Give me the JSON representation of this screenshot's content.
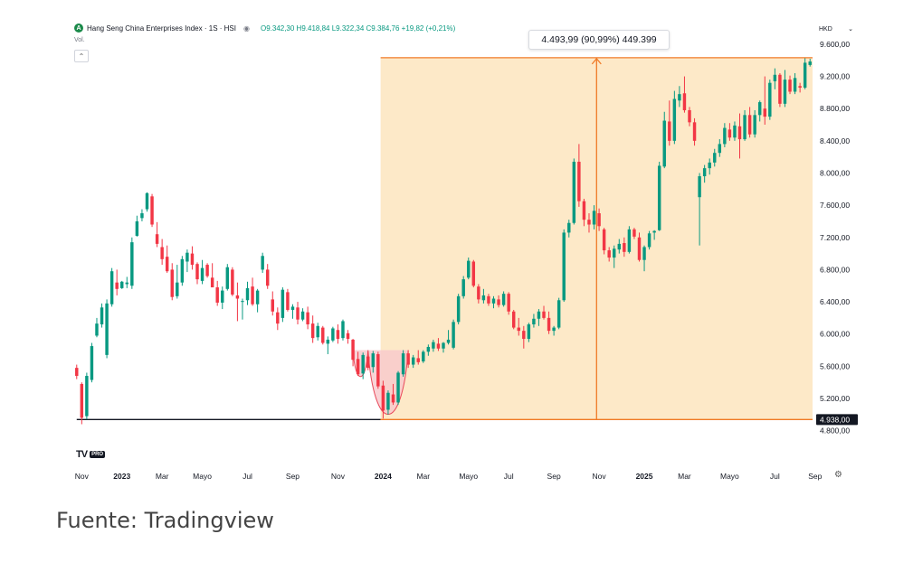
{
  "header": {
    "logo_letter": "A",
    "symbol": "Hang Seng China Enterprises Index · 1S · HSI",
    "ohlc": "O9.342,30 H9.418,84 L9.322,34 C9.384,76 +19,82 (+0,21%)",
    "eye_icon": "eye-icon",
    "volume_label": "Vol.",
    "collapse_icon": "chevron-up-icon"
  },
  "currency": {
    "label": "HKD",
    "dropdown_icon": "chevron-down-icon"
  },
  "measure_tooltip": "4.493,99 (90,99%) 449.399",
  "branding": {
    "mark": "TV",
    "badge": "PRO"
  },
  "settings_icon": "gear-icon",
  "source": "Fuente: Tradingview",
  "colors": {
    "up": "#089981",
    "down": "#f23645",
    "measure_fill": "#fde9c8",
    "measure_line": "#f07a27",
    "pattern_fill": "#f8c8cc",
    "baseline": "#131722"
  },
  "chart_data": {
    "type": "candlestick",
    "title": "Hang Seng China Enterprises Index · 1S · HSI",
    "interval": "1S",
    "currency": "HKD",
    "ylim": [
      4650,
      9700
    ],
    "y_ticks": [
      {
        "value": 9600,
        "label": "9.600,00"
      },
      {
        "value": 9200,
        "label": "9.200,00"
      },
      {
        "value": 8800,
        "label": "8.800,00"
      },
      {
        "value": 8400,
        "label": "8.400,00"
      },
      {
        "value": 8000,
        "label": "8.000,00"
      },
      {
        "value": 7600,
        "label": "7.600,00"
      },
      {
        "value": 7200,
        "label": "7.200,00"
      },
      {
        "value": 6800,
        "label": "6.800,00"
      },
      {
        "value": 6400,
        "label": "6.400,00"
      },
      {
        "value": 6000,
        "label": "6.000,00"
      },
      {
        "value": 5600,
        "label": "5.600,00"
      },
      {
        "value": 5200,
        "label": "5.200,00"
      },
      {
        "value": 4800,
        "label": "4.800,00"
      }
    ],
    "x_ticks": [
      {
        "index": 1,
        "label": "Nov",
        "bold": false
      },
      {
        "index": 9,
        "label": "2023",
        "bold": true
      },
      {
        "index": 17,
        "label": "Mar",
        "bold": false
      },
      {
        "index": 25,
        "label": "Mayo",
        "bold": false
      },
      {
        "index": 34,
        "label": "Jul",
        "bold": false
      },
      {
        "index": 43,
        "label": "Sep",
        "bold": false
      },
      {
        "index": 52,
        "label": "Nov",
        "bold": false
      },
      {
        "index": 61,
        "label": "2024",
        "bold": true
      },
      {
        "index": 69,
        "label": "Mar",
        "bold": false
      },
      {
        "index": 78,
        "label": "Mayo",
        "bold": false
      },
      {
        "index": 86,
        "label": "Jul",
        "bold": false
      },
      {
        "index": 95,
        "label": "Sep",
        "bold": false
      },
      {
        "index": 104,
        "label": "Nov",
        "bold": false
      },
      {
        "index": 113,
        "label": "2025",
        "bold": true
      },
      {
        "index": 121,
        "label": "Mar",
        "bold": false
      },
      {
        "index": 130,
        "label": "Mayo",
        "bold": false
      },
      {
        "index": 139,
        "label": "Jul",
        "bold": false
      },
      {
        "index": 147,
        "label": "Sep",
        "bold": false
      }
    ],
    "price_label": {
      "value": 4938,
      "label": "4.938,00"
    },
    "baseline_start_index": 1,
    "measure": {
      "from_index": 61,
      "low": 4938,
      "high": 9432
    },
    "rounding_bottoms": [
      {
        "from_index": 55,
        "to_index": 58,
        "level": 5800,
        "bottom": 5450
      },
      {
        "from_index": 58,
        "to_index": 66,
        "level": 5800,
        "bottom": 4950
      }
    ],
    "candles": [
      {
        "o": 5580,
        "h": 5620,
        "l": 5440,
        "c": 5480
      },
      {
        "o": 5380,
        "h": 5400,
        "l": 4880,
        "c": 4960
      },
      {
        "o": 4980,
        "h": 5520,
        "l": 4940,
        "c": 5480
      },
      {
        "o": 5430,
        "h": 5890,
        "l": 5400,
        "c": 5850
      },
      {
        "o": 5980,
        "h": 6200,
        "l": 5960,
        "c": 6130
      },
      {
        "o": 6120,
        "h": 6380,
        "l": 6080,
        "c": 6330
      },
      {
        "o": 5740,
        "h": 6430,
        "l": 5700,
        "c": 6380
      },
      {
        "o": 6370,
        "h": 6820,
        "l": 6340,
        "c": 6780
      },
      {
        "o": 6640,
        "h": 6800,
        "l": 6480,
        "c": 6560
      },
      {
        "o": 6570,
        "h": 6660,
        "l": 6560,
        "c": 6650
      },
      {
        "o": 6620,
        "h": 6710,
        "l": 6570,
        "c": 6640
      },
      {
        "o": 6600,
        "h": 7200,
        "l": 6560,
        "c": 7140
      },
      {
        "o": 7220,
        "h": 7470,
        "l": 7210,
        "c": 7400
      },
      {
        "o": 7440,
        "h": 7550,
        "l": 7400,
        "c": 7500
      },
      {
        "o": 7550,
        "h": 7760,
        "l": 7520,
        "c": 7750
      },
      {
        "o": 7710,
        "h": 7740,
        "l": 7330,
        "c": 7360
      },
      {
        "o": 7240,
        "h": 7390,
        "l": 7080,
        "c": 7120
      },
      {
        "o": 7080,
        "h": 7180,
        "l": 6860,
        "c": 6930
      },
      {
        "o": 6960,
        "h": 7100,
        "l": 6760,
        "c": 6780
      },
      {
        "o": 6800,
        "h": 6880,
        "l": 6420,
        "c": 6460
      },
      {
        "o": 6470,
        "h": 6860,
        "l": 6440,
        "c": 6640
      },
      {
        "o": 6640,
        "h": 6970,
        "l": 6600,
        "c": 6930
      },
      {
        "o": 6900,
        "h": 7050,
        "l": 6770,
        "c": 7010
      },
      {
        "o": 7000,
        "h": 7090,
        "l": 6800,
        "c": 6860
      },
      {
        "o": 6870,
        "h": 6890,
        "l": 6620,
        "c": 6680
      },
      {
        "o": 6660,
        "h": 6920,
        "l": 6620,
        "c": 6820
      },
      {
        "o": 6860,
        "h": 6880,
        "l": 6700,
        "c": 6720
      },
      {
        "o": 6700,
        "h": 6880,
        "l": 6580,
        "c": 6580
      },
      {
        "o": 6580,
        "h": 6660,
        "l": 6350,
        "c": 6390
      },
      {
        "o": 6390,
        "h": 6590,
        "l": 6310,
        "c": 6540
      },
      {
        "o": 6560,
        "h": 6870,
        "l": 6540,
        "c": 6830
      },
      {
        "o": 6800,
        "h": 6830,
        "l": 6470,
        "c": 6490
      },
      {
        "o": 6480,
        "h": 6640,
        "l": 6160,
        "c": 6440
      },
      {
        "o": 6400,
        "h": 6440,
        "l": 6180,
        "c": 6410
      },
      {
        "o": 6420,
        "h": 6650,
        "l": 6360,
        "c": 6570
      },
      {
        "o": 6590,
        "h": 6700,
        "l": 6350,
        "c": 6370
      },
      {
        "o": 6370,
        "h": 6560,
        "l": 6270,
        "c": 6540
      },
      {
        "o": 6800,
        "h": 7010,
        "l": 6760,
        "c": 6970
      },
      {
        "o": 6800,
        "h": 6870,
        "l": 6560,
        "c": 6600
      },
      {
        "o": 6430,
        "h": 6530,
        "l": 6230,
        "c": 6280
      },
      {
        "o": 6270,
        "h": 6330,
        "l": 6050,
        "c": 6130
      },
      {
        "o": 6200,
        "h": 6580,
        "l": 6150,
        "c": 6550
      },
      {
        "o": 6520,
        "h": 6560,
        "l": 6280,
        "c": 6300
      },
      {
        "o": 6300,
        "h": 6370,
        "l": 6190,
        "c": 6340
      },
      {
        "o": 6330,
        "h": 6400,
        "l": 6120,
        "c": 6180
      },
      {
        "o": 6180,
        "h": 6320,
        "l": 6160,
        "c": 6280
      },
      {
        "o": 6270,
        "h": 6340,
        "l": 6060,
        "c": 6120
      },
      {
        "o": 6130,
        "h": 6230,
        "l": 5890,
        "c": 5950
      },
      {
        "o": 5960,
        "h": 6140,
        "l": 5920,
        "c": 6100
      },
      {
        "o": 6080,
        "h": 6100,
        "l": 5870,
        "c": 5890
      },
      {
        "o": 5880,
        "h": 5970,
        "l": 5750,
        "c": 5930
      },
      {
        "o": 5920,
        "h": 6090,
        "l": 5900,
        "c": 6070
      },
      {
        "o": 6050,
        "h": 6120,
        "l": 5880,
        "c": 5940
      },
      {
        "o": 5950,
        "h": 6180,
        "l": 5920,
        "c": 6160
      },
      {
        "o": 6010,
        "h": 6050,
        "l": 5880,
        "c": 5940
      },
      {
        "o": 5930,
        "h": 5940,
        "l": 5600,
        "c": 5680
      },
      {
        "o": 5690,
        "h": 5780,
        "l": 5480,
        "c": 5500
      },
      {
        "o": 5510,
        "h": 5770,
        "l": 5440,
        "c": 5740
      },
      {
        "o": 5720,
        "h": 5780,
        "l": 5550,
        "c": 5580
      },
      {
        "o": 5590,
        "h": 5790,
        "l": 5520,
        "c": 5760
      },
      {
        "o": 5750,
        "h": 5780,
        "l": 5320,
        "c": 5350
      },
      {
        "o": 5360,
        "h": 5420,
        "l": 4950,
        "c": 5050
      },
      {
        "o": 5060,
        "h": 5300,
        "l": 5000,
        "c": 5270
      },
      {
        "o": 5250,
        "h": 5380,
        "l": 5120,
        "c": 5150
      },
      {
        "o": 5150,
        "h": 5540,
        "l": 5120,
        "c": 5520
      },
      {
        "o": 5500,
        "h": 5800,
        "l": 5470,
        "c": 5760
      },
      {
        "o": 5760,
        "h": 5800,
        "l": 5580,
        "c": 5620
      },
      {
        "o": 5620,
        "h": 5740,
        "l": 5580,
        "c": 5710
      },
      {
        "o": 5700,
        "h": 5800,
        "l": 5620,
        "c": 5650
      },
      {
        "o": 5660,
        "h": 5800,
        "l": 5640,
        "c": 5780
      },
      {
        "o": 5780,
        "h": 5870,
        "l": 5730,
        "c": 5840
      },
      {
        "o": 5820,
        "h": 5930,
        "l": 5780,
        "c": 5900
      },
      {
        "o": 5880,
        "h": 5950,
        "l": 5790,
        "c": 5820
      },
      {
        "o": 5820,
        "h": 5900,
        "l": 5770,
        "c": 5890
      },
      {
        "o": 5890,
        "h": 6050,
        "l": 5870,
        "c": 5930
      },
      {
        "o": 5830,
        "h": 6180,
        "l": 5810,
        "c": 6150
      },
      {
        "o": 6150,
        "h": 6500,
        "l": 6120,
        "c": 6470
      },
      {
        "o": 6470,
        "h": 6720,
        "l": 6440,
        "c": 6680
      },
      {
        "o": 6700,
        "h": 6950,
        "l": 6680,
        "c": 6910
      },
      {
        "o": 6900,
        "h": 6920,
        "l": 6580,
        "c": 6600
      },
      {
        "o": 6590,
        "h": 6620,
        "l": 6380,
        "c": 6430
      },
      {
        "o": 6420,
        "h": 6560,
        "l": 6380,
        "c": 6480
      },
      {
        "o": 6470,
        "h": 6500,
        "l": 6350,
        "c": 6380
      },
      {
        "o": 6380,
        "h": 6470,
        "l": 6320,
        "c": 6440
      },
      {
        "o": 6430,
        "h": 6480,
        "l": 6330,
        "c": 6360
      },
      {
        "o": 6360,
        "h": 6530,
        "l": 6340,
        "c": 6500
      },
      {
        "o": 6500,
        "h": 6520,
        "l": 6240,
        "c": 6280
      },
      {
        "o": 6280,
        "h": 6300,
        "l": 6060,
        "c": 6080
      },
      {
        "o": 6080,
        "h": 6200,
        "l": 5980,
        "c": 6040
      },
      {
        "o": 6040,
        "h": 6100,
        "l": 5820,
        "c": 5940
      },
      {
        "o": 5940,
        "h": 6140,
        "l": 5900,
        "c": 6120
      },
      {
        "o": 6120,
        "h": 6250,
        "l": 6080,
        "c": 6190
      },
      {
        "o": 6190,
        "h": 6310,
        "l": 6100,
        "c": 6280
      },
      {
        "o": 6280,
        "h": 6350,
        "l": 6180,
        "c": 6200
      },
      {
        "o": 6200,
        "h": 6280,
        "l": 6000,
        "c": 6040
      },
      {
        "o": 6040,
        "h": 6100,
        "l": 5980,
        "c": 6080
      },
      {
        "o": 6080,
        "h": 6450,
        "l": 6060,
        "c": 6420
      },
      {
        "o": 6420,
        "h": 7300,
        "l": 6400,
        "c": 7260
      },
      {
        "o": 7260,
        "h": 7420,
        "l": 7200,
        "c": 7380
      },
      {
        "o": 7380,
        "h": 8180,
        "l": 7360,
        "c": 8140
      },
      {
        "o": 8140,
        "h": 8360,
        "l": 7580,
        "c": 7650
      },
      {
        "o": 7650,
        "h": 7680,
        "l": 7340,
        "c": 7420
      },
      {
        "o": 7420,
        "h": 7500,
        "l": 7260,
        "c": 7360
      },
      {
        "o": 7360,
        "h": 7600,
        "l": 7300,
        "c": 7530
      },
      {
        "o": 7500,
        "h": 7560,
        "l": 7280,
        "c": 7340
      },
      {
        "o": 7300,
        "h": 7320,
        "l": 6990,
        "c": 7040
      },
      {
        "o": 7040,
        "h": 7080,
        "l": 6900,
        "c": 6950
      },
      {
        "o": 6950,
        "h": 7100,
        "l": 6820,
        "c": 7060
      },
      {
        "o": 7050,
        "h": 7180,
        "l": 7000,
        "c": 7120
      },
      {
        "o": 7130,
        "h": 7200,
        "l": 6960,
        "c": 7020
      },
      {
        "o": 7020,
        "h": 7340,
        "l": 7000,
        "c": 7300
      },
      {
        "o": 7300,
        "h": 7320,
        "l": 7180,
        "c": 7210
      },
      {
        "o": 7200,
        "h": 7260,
        "l": 6900,
        "c": 6920
      },
      {
        "o": 6920,
        "h": 7100,
        "l": 6780,
        "c": 7080
      },
      {
        "o": 7080,
        "h": 7280,
        "l": 7050,
        "c": 7250
      },
      {
        "o": 7260,
        "h": 7290,
        "l": 7170,
        "c": 7280
      },
      {
        "o": 7290,
        "h": 8140,
        "l": 7280,
        "c": 8090
      },
      {
        "o": 8080,
        "h": 8760,
        "l": 8060,
        "c": 8650
      },
      {
        "o": 8640,
        "h": 8900,
        "l": 8340,
        "c": 8400
      },
      {
        "o": 8400,
        "h": 9020,
        "l": 8360,
        "c": 8920
      },
      {
        "o": 8900,
        "h": 9080,
        "l": 8820,
        "c": 8980
      },
      {
        "o": 8990,
        "h": 9200,
        "l": 8750,
        "c": 8780
      },
      {
        "o": 8780,
        "h": 8820,
        "l": 8580,
        "c": 8630
      },
      {
        "o": 8630,
        "h": 8680,
        "l": 8340,
        "c": 8400
      },
      {
        "o": 7700,
        "h": 8000,
        "l": 7100,
        "c": 7960
      },
      {
        "o": 7960,
        "h": 8100,
        "l": 7880,
        "c": 8060
      },
      {
        "o": 8060,
        "h": 8180,
        "l": 7980,
        "c": 8130
      },
      {
        "o": 8130,
        "h": 8300,
        "l": 8080,
        "c": 8250
      },
      {
        "o": 8250,
        "h": 8420,
        "l": 8200,
        "c": 8360
      },
      {
        "o": 8360,
        "h": 8620,
        "l": 8320,
        "c": 8560
      },
      {
        "o": 8540,
        "h": 8620,
        "l": 8400,
        "c": 8440
      },
      {
        "o": 8440,
        "h": 8640,
        "l": 8400,
        "c": 8590
      },
      {
        "o": 8580,
        "h": 8740,
        "l": 8180,
        "c": 8420
      },
      {
        "o": 8420,
        "h": 8780,
        "l": 8400,
        "c": 8720
      },
      {
        "o": 8720,
        "h": 8820,
        "l": 8440,
        "c": 8480
      },
      {
        "o": 8480,
        "h": 8780,
        "l": 8440,
        "c": 8720
      },
      {
        "o": 8720,
        "h": 8900,
        "l": 8640,
        "c": 8880
      },
      {
        "o": 8800,
        "h": 9200,
        "l": 8600,
        "c": 8700
      },
      {
        "o": 8700,
        "h": 9160,
        "l": 8660,
        "c": 9120
      },
      {
        "o": 9140,
        "h": 9300,
        "l": 9040,
        "c": 9220
      },
      {
        "o": 9220,
        "h": 9240,
        "l": 8820,
        "c": 8860
      },
      {
        "o": 8860,
        "h": 9280,
        "l": 8820,
        "c": 9160
      },
      {
        "o": 9160,
        "h": 9210,
        "l": 8980,
        "c": 9010
      },
      {
        "o": 9010,
        "h": 9240,
        "l": 8980,
        "c": 9180
      },
      {
        "o": 9080,
        "h": 9120,
        "l": 9000,
        "c": 9060
      },
      {
        "o": 9060,
        "h": 9430,
        "l": 9040,
        "c": 9370
      },
      {
        "o": 9342,
        "h": 9419,
        "l": 9322,
        "c": 9385
      }
    ]
  }
}
